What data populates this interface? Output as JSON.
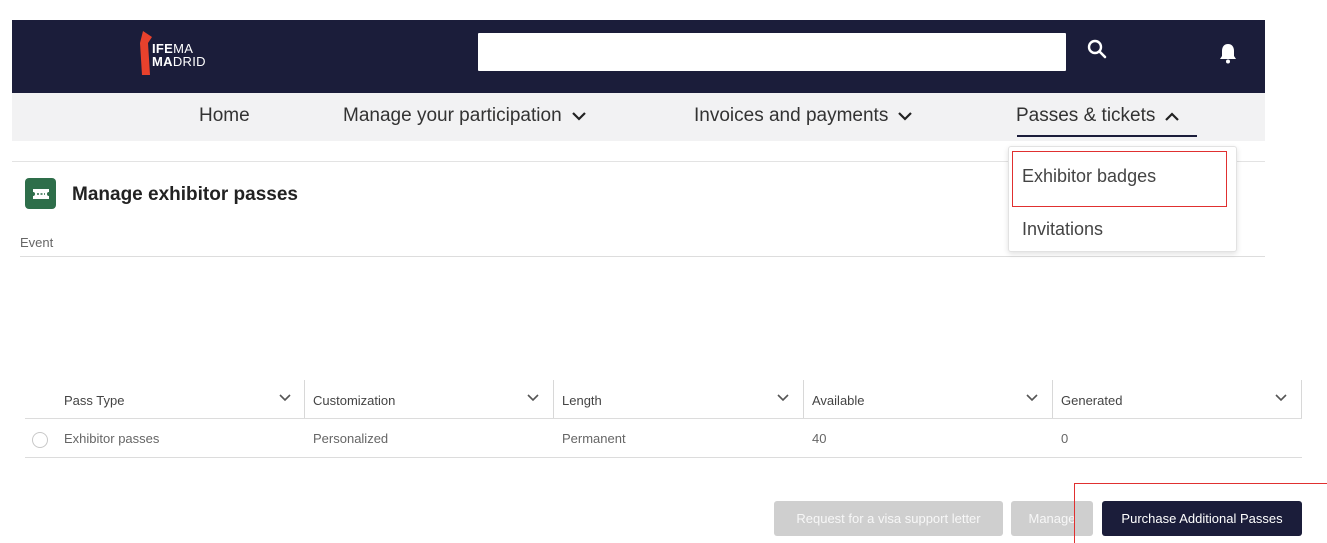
{
  "header": {
    "logo": {
      "line1_bold": "IFE",
      "line1_rest": "MA",
      "line2_bold": "MA",
      "line2_rest": "DRID"
    },
    "search": {
      "value": "",
      "placeholder": ""
    },
    "search_icon": "search-icon",
    "bell_icon": "bell-icon"
  },
  "nav": {
    "items": [
      {
        "label": "Home",
        "has_chevron": false
      },
      {
        "label": "Manage your participation",
        "has_chevron": true,
        "chevron": "down"
      },
      {
        "label": "Invoices and payments",
        "has_chevron": true,
        "chevron": "down"
      },
      {
        "label": "Passes & tickets",
        "has_chevron": true,
        "chevron": "up",
        "active": true
      }
    ],
    "dropdown": {
      "items": [
        {
          "label": "Exhibitor badges",
          "highlighted": true
        },
        {
          "label": "Invitations"
        }
      ]
    }
  },
  "page": {
    "title": "Manage exhibitor passes",
    "icon": "ticket-icon",
    "event_label": "Event"
  },
  "table": {
    "columns": [
      "Pass Type",
      "Customization",
      "Length",
      "Available",
      "Generated"
    ],
    "rows": [
      {
        "selected": false,
        "cells": [
          "Exhibitor passes",
          "Personalized",
          "Permanent",
          "40",
          "0"
        ]
      }
    ]
  },
  "actions": {
    "visa_label": "Request for a visa support letter",
    "manage_label": "Manage",
    "purchase_label": "Purchase Additional Passes"
  },
  "colors": {
    "header_bg": "#1b1d3a",
    "navbar_bg": "#f2f2f3",
    "brand_red": "#e8412c",
    "page_icon_bg": "#2e6e4a",
    "highlight_red": "#e03030",
    "disabled_button": "#cfcfcf"
  }
}
